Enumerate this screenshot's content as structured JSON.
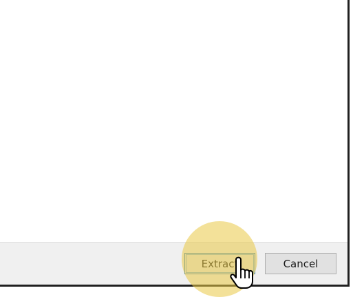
{
  "dialog": {
    "footer": {
      "extract_label": "Extract",
      "cancel_label": "Cancel"
    }
  },
  "overlay": {
    "cursor_icon": "hand-pointer-icon",
    "highlight_color": "#eac846"
  }
}
